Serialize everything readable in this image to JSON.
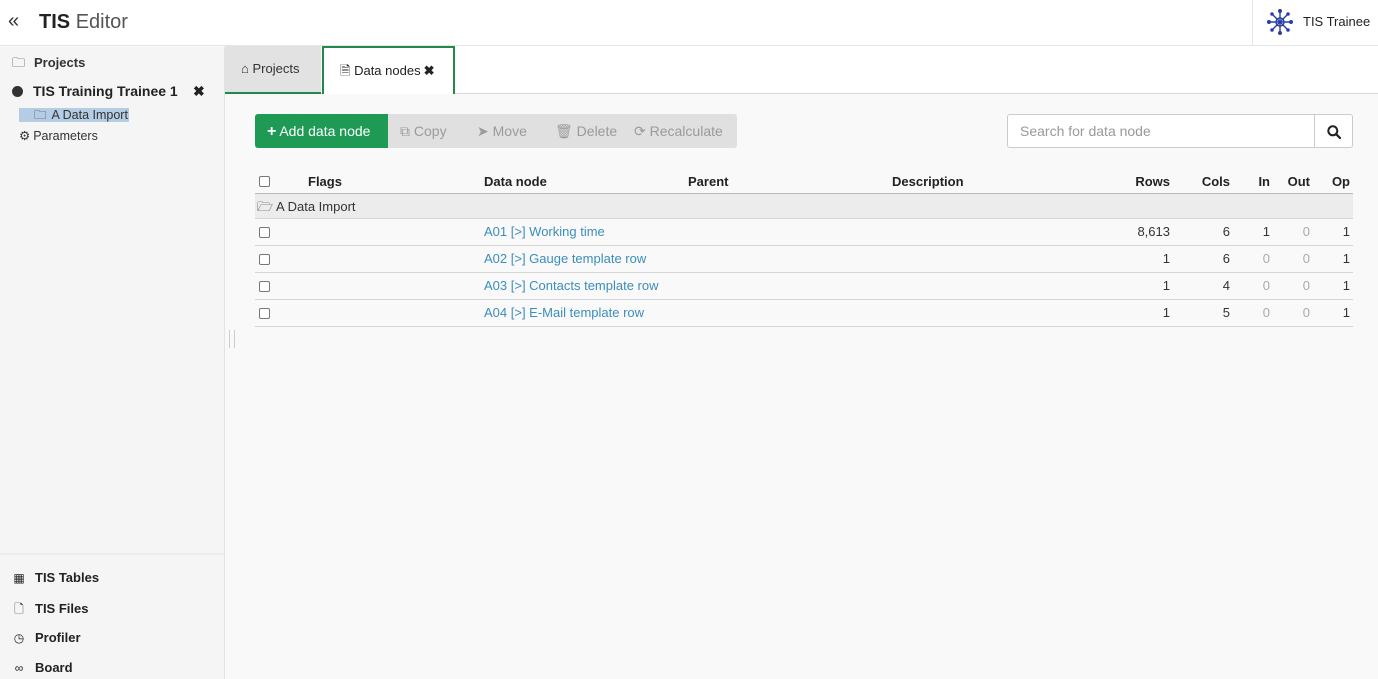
{
  "header": {
    "collapse_icon": "double-chevron-left-icon",
    "title_bold": "TIS",
    "title_light": "Editor",
    "user_name": "TIS Trainee",
    "user_logo": "network-logo-icon"
  },
  "sidebar": {
    "projects_label": "Projects",
    "project_name": "TIS Training Trainee 1",
    "folder_label": "A Data Import",
    "params_label": "Parameters",
    "bottom": [
      {
        "label": "TIS Tables",
        "icon": "table-icon"
      },
      {
        "label": "TIS Files",
        "icon": "file-icon"
      },
      {
        "label": "Profiler",
        "icon": "clock-icon"
      },
      {
        "label": "Board",
        "icon": "link-icon"
      }
    ]
  },
  "tabs": {
    "projects": "Projects",
    "data_nodes": "Data nodes"
  },
  "toolbar": {
    "add": "Add data node",
    "copy": "Copy",
    "move": "Move",
    "delete": "Delete",
    "recalculate": "Recalculate"
  },
  "search": {
    "placeholder": "Search for data node",
    "value": ""
  },
  "colors": {
    "accent_green": "#1e9a55",
    "link_blue": "#3c8dbc",
    "selection": "#b4cde4"
  },
  "table": {
    "headers": {
      "flags": "Flags",
      "data_node": "Data node",
      "parent": "Parent",
      "description": "Description",
      "rows": "Rows",
      "cols": "Cols",
      "in": "In",
      "out": "Out",
      "op": "Op"
    },
    "group": "A Data Import",
    "rows": [
      {
        "name": "A01 [>] Working time",
        "rows": "8,613",
        "cols": "6",
        "in": "1",
        "out": "0",
        "op": "1"
      },
      {
        "name": "A02 [>] Gauge template row",
        "rows": "1",
        "cols": "6",
        "in": "0",
        "out": "0",
        "op": "1"
      },
      {
        "name": "A03 [>] Contacts template row",
        "rows": "1",
        "cols": "4",
        "in": "0",
        "out": "0",
        "op": "1"
      },
      {
        "name": "A04 [>] E-Mail template row",
        "rows": "1",
        "cols": "5",
        "in": "0",
        "out": "0",
        "op": "1"
      }
    ]
  }
}
